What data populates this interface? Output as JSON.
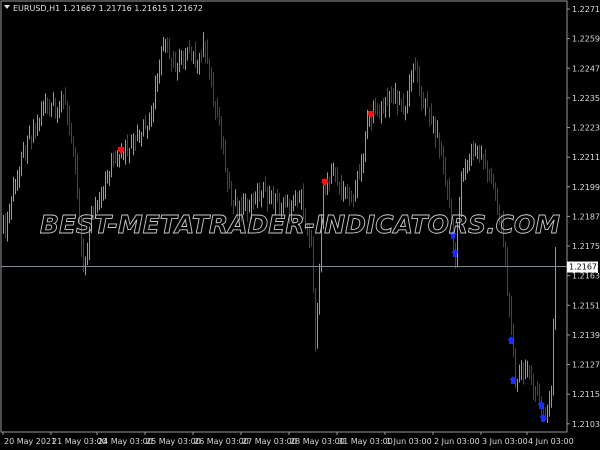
{
  "header": {
    "symbol": "EURUSD,H1",
    "ohlc": "1.21667 1.21716 1.21615 1.21672"
  },
  "watermark": "BEST-METATRADER-INDICATORS.COM",
  "colors": {
    "up_bar": "#b8a418",
    "down_bar": "#7a1f7a",
    "sell_marker": "#ff1010",
    "buy_marker": "#1a2cff",
    "frame": "#9a9a9a",
    "current_line": "#7f8a99"
  },
  "chart_data": {
    "type": "bar",
    "title": "EURUSD,H1",
    "current_price": 1.21672,
    "current_price_label": "1.21672",
    "ylim": [
      1.20995,
      1.22755
    ],
    "y_ticks": [
      "1.22715",
      "1.22595",
      "1.22475",
      "1.22355",
      "1.22235",
      "1.22115",
      "1.21995",
      "1.21875",
      "1.21755",
      "1.21635",
      "1.21515",
      "1.21395",
      "1.21275",
      "1.21155",
      "1.21035"
    ],
    "x_ticks": [
      {
        "bar": 1,
        "label": "20 May 2021"
      },
      {
        "bar": 25,
        "label": "21 May 03:00"
      },
      {
        "bar": 48,
        "label": "24 May 03:00"
      },
      {
        "bar": 72,
        "label": "25 May 03:00"
      },
      {
        "bar": 96,
        "label": "26 May 03:00"
      },
      {
        "bar": 120,
        "label": "27 May 03:00"
      },
      {
        "bar": 144,
        "label": "28 May 03:00"
      },
      {
        "bar": 168,
        "label": "31 May 03:00"
      },
      {
        "bar": 192,
        "label": "1 Jun 03:00"
      },
      {
        "bar": 216,
        "label": "2 Jun 03:00"
      },
      {
        "bar": 240,
        "label": "3 Jun 03:00"
      },
      {
        "bar": 263,
        "label": "4 Jun 03:00"
      }
    ],
    "close_waypoints": [
      [
        2,
        1.2182
      ],
      [
        7,
        1.22022
      ],
      [
        12,
        1.22144
      ],
      [
        17,
        1.22225
      ],
      [
        22,
        1.22346
      ],
      [
        27,
        1.22326
      ],
      [
        32,
        1.22346
      ],
      [
        37,
        1.22063
      ],
      [
        41,
        1.21638
      ],
      [
        45,
        1.2186
      ],
      [
        50,
        1.21982
      ],
      [
        55,
        1.22083
      ],
      [
        60,
        1.22144
      ],
      [
        65,
        1.22184
      ],
      [
        70,
        1.22225
      ],
      [
        75,
        1.22286
      ],
      [
        79,
        1.22508
      ],
      [
        82,
        1.22589
      ],
      [
        87,
        1.22468
      ],
      [
        92,
        1.22549
      ],
      [
        97,
        1.22508
      ],
      [
        102,
        1.22569
      ],
      [
        106,
        1.22346
      ],
      [
        110,
        1.22184
      ],
      [
        115,
        1.21941
      ],
      [
        120,
        1.21901
      ],
      [
        125,
        1.21941
      ],
      [
        130,
        1.21982
      ],
      [
        135,
        1.21941
      ],
      [
        140,
        1.21921
      ],
      [
        145,
        1.21901
      ],
      [
        150,
        1.21941
      ],
      [
        155,
        1.21739
      ],
      [
        157,
        1.21374
      ],
      [
        161,
        1.21982
      ],
      [
        165,
        1.22043
      ],
      [
        170,
        1.21982
      ],
      [
        175,
        1.21941
      ],
      [
        180,
        1.22063
      ],
      [
        184,
        1.22306
      ],
      [
        187,
        1.22286
      ],
      [
        192,
        1.22346
      ],
      [
        197,
        1.22367
      ],
      [
        202,
        1.22306
      ],
      [
        206,
        1.22508
      ],
      [
        210,
        1.22346
      ],
      [
        215,
        1.22265
      ],
      [
        220,
        1.22144
      ],
      [
        225,
        1.2186
      ],
      [
        227,
        1.21698
      ],
      [
        230,
        1.22022
      ],
      [
        235,
        1.22144
      ],
      [
        240,
        1.22103
      ],
      [
        245,
        1.22022
      ],
      [
        250,
        1.2184
      ],
      [
        252,
        1.21698
      ],
      [
        255,
        1.21374
      ],
      [
        257,
        1.21212
      ],
      [
        260,
        1.21253
      ],
      [
        265,
        1.21233
      ],
      [
        270,
        1.21091
      ],
      [
        272,
        1.2105
      ],
      [
        275,
        1.21172
      ],
      [
        277,
        1.21698
      ]
    ],
    "markers": [
      {
        "bar": 60,
        "price": 1.22144,
        "type": "sell"
      },
      {
        "bar": 162,
        "price": 1.22015,
        "type": "sell"
      },
      {
        "bar": 185,
        "price": 1.2229,
        "type": "sell"
      },
      {
        "bar": 226,
        "price": 1.218,
        "type": "buy"
      },
      {
        "bar": 227,
        "price": 1.21727,
        "type": "buy"
      },
      {
        "bar": 255,
        "price": 1.21374,
        "type": "buy"
      },
      {
        "bar": 256,
        "price": 1.21212,
        "type": "buy"
      },
      {
        "bar": 270,
        "price": 1.21111,
        "type": "buy"
      },
      {
        "bar": 271,
        "price": 1.21059,
        "type": "buy"
      }
    ]
  }
}
